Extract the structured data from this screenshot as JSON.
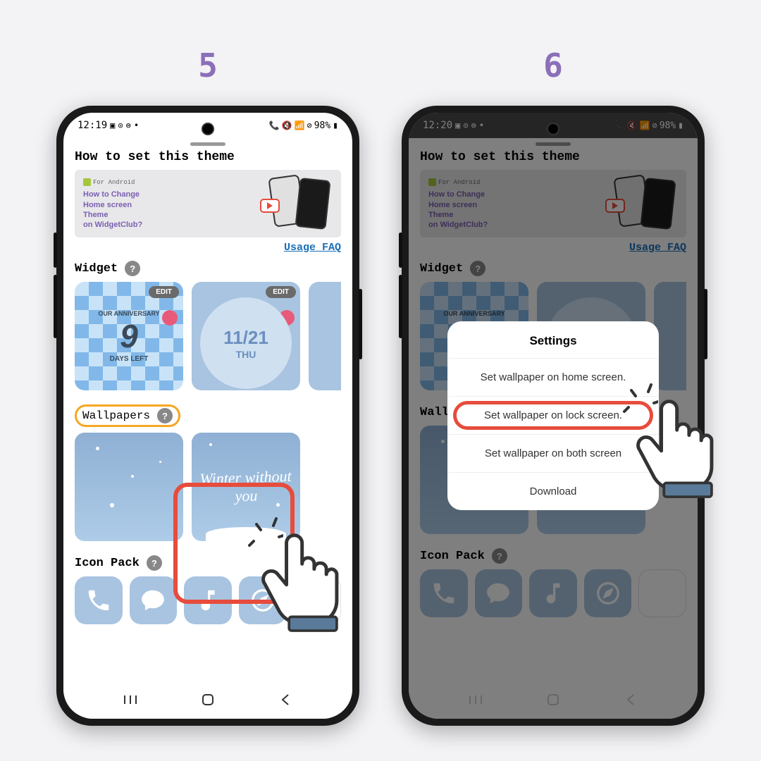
{
  "steps": {
    "left": "5",
    "right": "6"
  },
  "status": {
    "time5": "12:19",
    "time6": "12:20",
    "battery": "98%",
    "icons_left": "▣ ⊙ 💬 •",
    "icons_right": "📞 🔇 📶 ⊘"
  },
  "page": {
    "title": "How to set this theme",
    "faq_link": "Usage FAQ"
  },
  "promo": {
    "badge": "For Android",
    "line1": "How to Change",
    "line2": "Home screen",
    "line3": "Theme",
    "line4": "on WidgetClub?",
    "tag": "WidgetClub"
  },
  "sections": {
    "widget": "Widget",
    "wallpapers": "Wallpapers",
    "iconpack": "Icon Pack",
    "help": "?"
  },
  "widgets": {
    "edit_label": "EDIT",
    "card1": {
      "header": "OUR ANNIVERSARY",
      "number": "9",
      "footer": "DAYS LEFT"
    },
    "card2": {
      "date": "11/21",
      "day": "THU"
    }
  },
  "wallpapers": {
    "script_text": "Winter\nwithout you"
  },
  "dialog": {
    "title": "Settings",
    "opt1": "Set wallpaper on home screen.",
    "opt2": "Set wallpaper on lock screen.",
    "opt3": "Set wallpaper on both screen",
    "opt4": "Download"
  },
  "colors": {
    "accent": "#8b6fb8",
    "highlight_red": "#e74c3c",
    "highlight_orange": "#f5a623",
    "blue_soft": "#a8c4e0"
  }
}
